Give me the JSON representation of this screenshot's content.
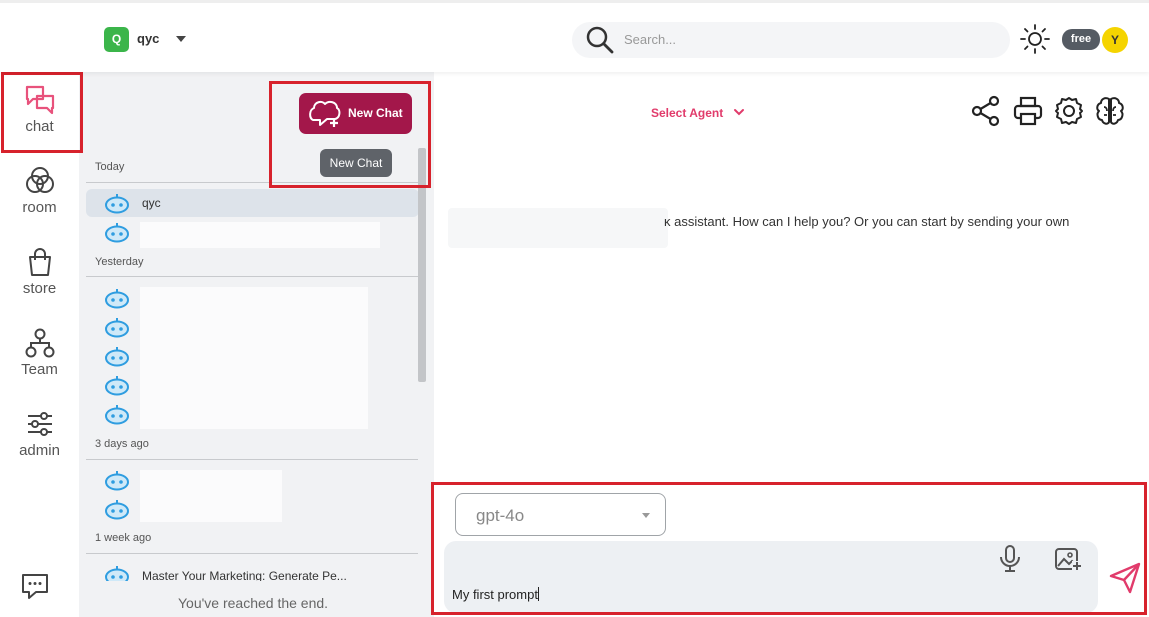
{
  "header": {
    "workspace_initial": "Q",
    "workspace_name": "qyc",
    "search_placeholder": "Search...",
    "plan_label": "free",
    "avatar_initial": "Y"
  },
  "rail": {
    "items": [
      {
        "label": "chat",
        "icon": "chat-bubbles-icon"
      },
      {
        "label": "room",
        "icon": "rings-icon"
      },
      {
        "label": "store",
        "icon": "shopping-bag-icon"
      },
      {
        "label": "Team",
        "icon": "org-chart-icon"
      },
      {
        "label": "admin",
        "icon": "sliders-icon"
      }
    ],
    "feedback_icon": "chat-feedback-icon"
  },
  "history": {
    "new_chat_label": "New Chat",
    "tooltip": "New Chat",
    "groups": [
      {
        "label": "Today",
        "items": [
          {
            "title": "qyc"
          },
          {
            "title": ""
          }
        ]
      },
      {
        "label": "Yesterday",
        "items": [
          {
            "title": ""
          },
          {
            "title": ""
          },
          {
            "title": ""
          },
          {
            "title": ""
          },
          {
            "title": ""
          }
        ]
      },
      {
        "label": "3 days ago",
        "items": [
          {
            "title": ""
          },
          {
            "title": ""
          }
        ]
      },
      {
        "label": "1 week ago",
        "items": [
          {
            "title": "Master Your Marketing: Generate Pe..."
          }
        ]
      }
    ],
    "end_text": "You've reached the end."
  },
  "main": {
    "agent_select": "Select Agent",
    "tools": [
      "share-icon",
      "print-icon",
      "settings-icon",
      "brain-icon"
    ],
    "assistant_message": "ĸ assistant. How can I help you? Or you can start by sending your own"
  },
  "composer": {
    "model": "gpt-4o",
    "prompt_text": "My first prompt"
  },
  "colors": {
    "brand": "#a3174a",
    "accent_pink": "#e13b6b",
    "highlight": "#d7222c",
    "workspace_badge": "#3bb54a",
    "avatar": "#f5d400"
  }
}
